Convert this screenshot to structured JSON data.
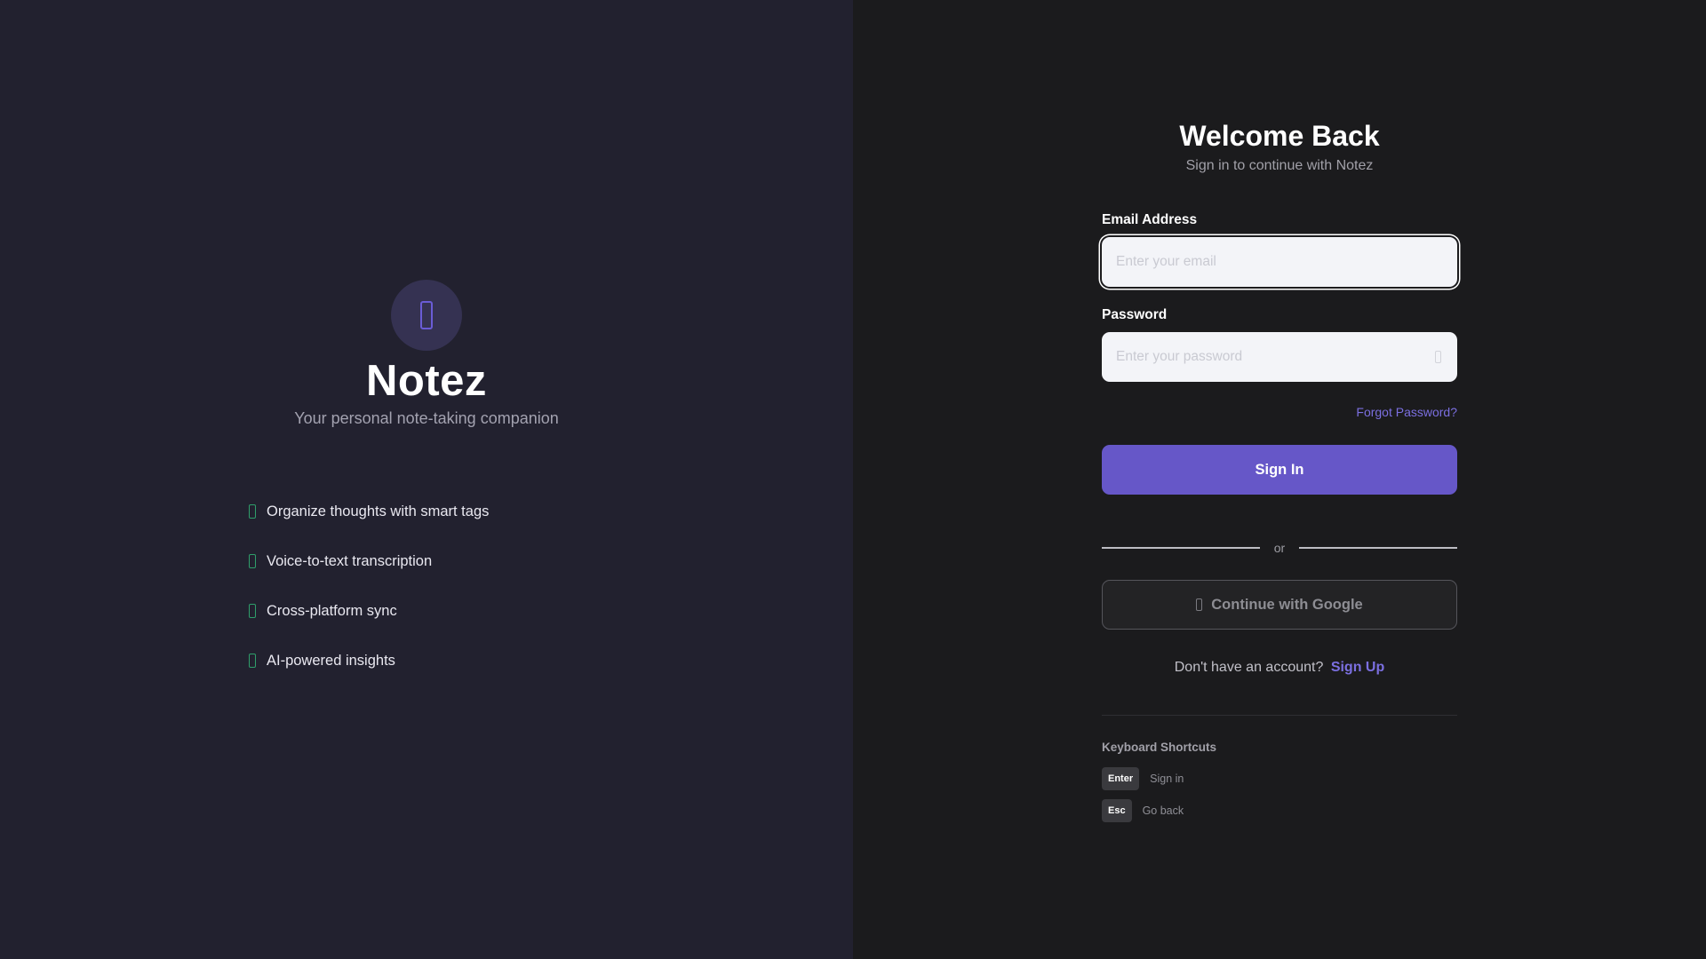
{
  "brand": {
    "logo_icon": "notebook-icon",
    "name": "Notez",
    "tagline": "Your personal note-taking companion",
    "features": [
      {
        "icon": "check-icon",
        "text": "Organize thoughts with smart tags"
      },
      {
        "icon": "check-icon",
        "text": "Voice-to-text transcription"
      },
      {
        "icon": "check-icon",
        "text": "Cross-platform sync"
      },
      {
        "icon": "check-icon",
        "text": "AI-powered insights"
      }
    ]
  },
  "form": {
    "title": "Welcome Back",
    "subtitle": "Sign in to continue with Notez",
    "email": {
      "label": "Email Address",
      "placeholder": "Enter your email",
      "value": ""
    },
    "password": {
      "label": "Password",
      "placeholder": "Enter your password",
      "value": "",
      "toggle_icon": "eye-icon"
    },
    "forgot_password": "Forgot Password?",
    "signin_button": "Sign In",
    "divider": "or",
    "google_button": {
      "icon": "google-icon",
      "label": "Continue with Google"
    },
    "signup_prompt": "Don't have an account?",
    "signup_link": "Sign Up"
  },
  "shortcuts": {
    "title": "Keyboard Shortcuts",
    "items": [
      {
        "key": "Enter",
        "description": "Sign in"
      },
      {
        "key": "Esc",
        "description": "Go back"
      }
    ]
  },
  "colors": {
    "left_background": "#22212f",
    "right_background": "#1b1b1d",
    "accent": "#6657c8",
    "link": "#7b6fe0",
    "feature_icon": "#2f9e6b"
  }
}
